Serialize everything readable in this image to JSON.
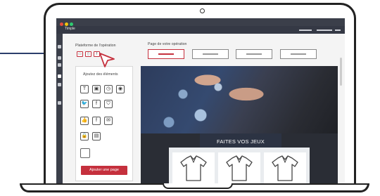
{
  "app": {
    "title": "Timple",
    "window_dots": [
      "#e74c3c",
      "#f1c40f",
      "#2ecc71"
    ]
  },
  "platform": {
    "label": "Plateforme de l'opération",
    "buttons": [
      {
        "icon": "desktop-icon",
        "glyph": "▭"
      },
      {
        "icon": "mobile-icon",
        "glyph": "▯"
      },
      {
        "icon": "facebook-icon",
        "glyph": "f"
      }
    ]
  },
  "pages": {
    "label": "Page de votre opération",
    "count": 4,
    "active_index": 0
  },
  "elements_panel": {
    "title": "Ajoutez des éléments",
    "rows": [
      [
        {
          "icon": "text-icon",
          "glyph": "T"
        },
        {
          "icon": "image-icon",
          "glyph": "▣"
        },
        {
          "icon": "timer-icon",
          "glyph": "◷"
        },
        {
          "icon": "camera-icon",
          "glyph": "◉"
        }
      ],
      [
        {
          "icon": "twitter-icon",
          "glyph": "🐦"
        },
        {
          "icon": "facebook-icon",
          "glyph": "f"
        },
        {
          "icon": "badge-icon",
          "glyph": "⛉"
        }
      ],
      [
        {
          "icon": "like-icon",
          "glyph": "👍"
        },
        {
          "icon": "facebook-share-icon",
          "glyph": "f"
        },
        {
          "icon": "mail-icon",
          "glyph": "✉"
        }
      ],
      [
        {
          "icon": "lock-icon",
          "glyph": "🔒"
        },
        {
          "icon": "card-icon",
          "glyph": "▤"
        }
      ],
      [
        {
          "icon": "empty-box-icon",
          "glyph": ""
        }
      ]
    ],
    "add_page_label": "Ajouter une page"
  },
  "preview": {
    "banner_text": "FAITES VOS JEUX",
    "products": [
      "polo-shirt-icon",
      "polo-shirt-icon",
      "polo-shirt-icon"
    ]
  },
  "colors": {
    "accent": "#c5303d",
    "dark_bar": "#3b3f4a",
    "banner": "#2c3343"
  }
}
